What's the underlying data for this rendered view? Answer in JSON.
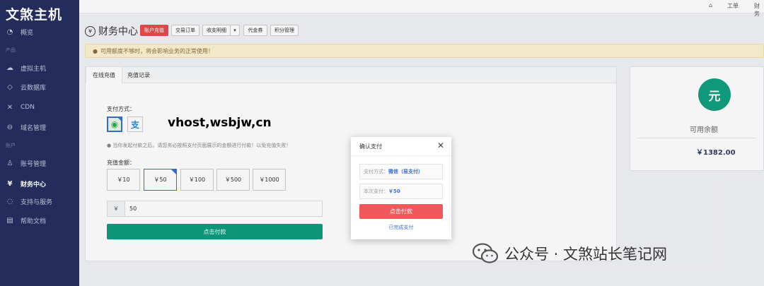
{
  "brand": "文煞主机",
  "sidebar": {
    "items": [
      {
        "label": "概览",
        "icon": "dashboard-icon"
      },
      {
        "label": "虚拟主机",
        "icon": "cloud-icon"
      },
      {
        "label": "云数据库",
        "icon": "database-layers-icon"
      },
      {
        "label": "CDN",
        "icon": "network-icon"
      },
      {
        "label": "域名管理",
        "icon": "globe-icon"
      },
      {
        "label": "账号管理",
        "icon": "user-icon"
      },
      {
        "label": "财务中心",
        "icon": "yen-icon"
      },
      {
        "label": "支持与服务",
        "icon": "chat-icon"
      },
      {
        "label": "帮助文档",
        "icon": "document-icon"
      }
    ],
    "section_product": "产品",
    "section_account": "账户"
  },
  "topbar": {
    "home_icon": "home-icon",
    "ticket": "工单",
    "finance": "财务"
  },
  "page": {
    "title": "财务中心",
    "buttons": {
      "recharge": "账户充值",
      "orders": "交易订单",
      "details": "收支明细",
      "voucher": "代金券",
      "points": "积分管理"
    },
    "alert": "可用额度不够时，将会影响业务的正常使用！"
  },
  "tabs": [
    "在线充值",
    "充值记录"
  ],
  "recharge": {
    "pay_method_label": "支付方式：",
    "hint": "当你发起付款之后，请您务必按照支付页面展示的金额进行付款！以免充值失败！",
    "amount_label": "充值金额：",
    "amounts": [
      "￥10",
      "￥50",
      "￥100",
      "￥500",
      "￥1000"
    ],
    "currency_prefix": "￥",
    "amount_value": "50",
    "pay_button": "点击付款"
  },
  "balance": {
    "symbol": "元",
    "label": "可用余额",
    "value": "￥1382.00"
  },
  "modal": {
    "title": "确认支付",
    "method_key": "支付方式：",
    "method_value": "微信（易支付）",
    "amount_key": "本次支付：",
    "amount_value": "￥50",
    "pay_button": "点击付款",
    "done_link": "已完成支付"
  },
  "overlay_text": "vhost,wsbjw,cn",
  "watermark": "公众号 · 文煞站长笔记网",
  "colors": {
    "sidebar": "#252e5e",
    "primary": "#3a6fd8",
    "green": "#0f9b7b",
    "danger": "#e84b4b",
    "modal_pay": "#f0585c"
  }
}
